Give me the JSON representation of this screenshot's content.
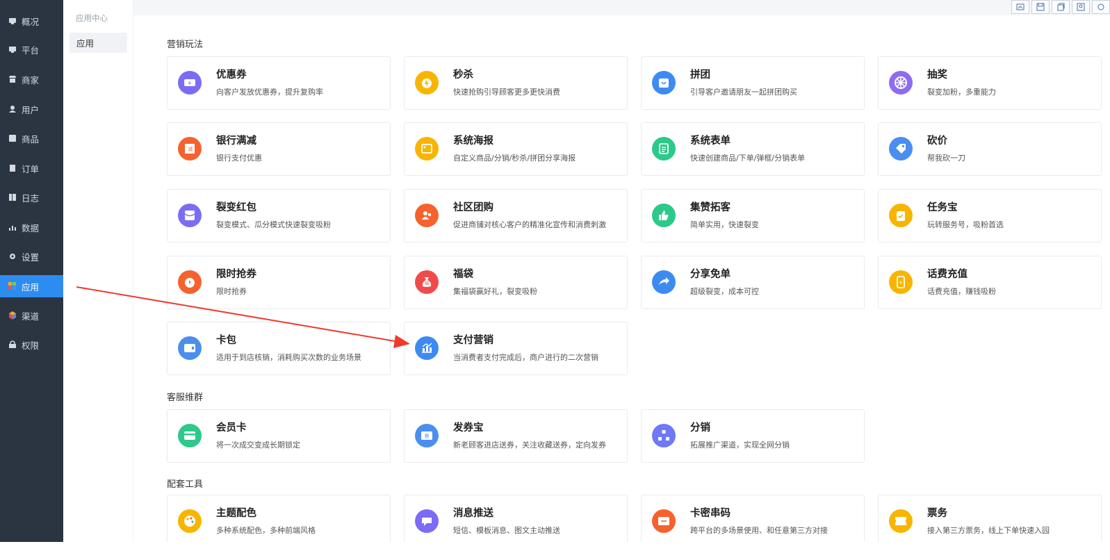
{
  "sidebar": {
    "items": [
      {
        "label": "概况",
        "icon": "dashboard-icon"
      },
      {
        "label": "平台",
        "icon": "monitor-icon"
      },
      {
        "label": "商家",
        "icon": "store-icon"
      },
      {
        "label": "用户",
        "icon": "user-icon"
      },
      {
        "label": "商品",
        "icon": "goods-icon"
      },
      {
        "label": "订单",
        "icon": "order-icon"
      },
      {
        "label": "日志",
        "icon": "log-icon"
      },
      {
        "label": "数据",
        "icon": "chart-icon"
      },
      {
        "label": "设置",
        "icon": "gear-icon"
      },
      {
        "label": "应用",
        "icon": "apps-icon"
      },
      {
        "label": "渠道",
        "icon": "cube-icon"
      },
      {
        "label": "权限",
        "icon": "lock-icon"
      }
    ],
    "active": "应用"
  },
  "subnav": {
    "title": "应用中心",
    "item": "应用"
  },
  "sections": [
    {
      "title": "营销玩法",
      "cards": [
        {
          "title": "优惠券",
          "desc": "向客户发放优惠券，提升复购率",
          "color": "#7b6cf6",
          "icon": "coupon-icon"
        },
        {
          "title": "秒杀",
          "desc": "快速抢购引导顾客更多更快消费",
          "color": "#f8b500",
          "icon": "alarm-clock-icon"
        },
        {
          "title": "拼团",
          "desc": "引导客户邀请朋友一起拼团购买",
          "color": "#3d8bf2",
          "icon": "shopping-bag-icon"
        },
        {
          "title": "抽奖",
          "desc": "裂变加粉，多重能力",
          "color": "#8e6cf2",
          "icon": "lottery-wheel-icon"
        },
        {
          "title": "银行满减",
          "desc": "银行支付优惠",
          "color": "#f6622d",
          "icon": "discount-icon"
        },
        {
          "title": "系统海报",
          "desc": "自定义商品/分销/秒杀/拼团分享海报",
          "color": "#f8b500",
          "icon": "image-icon"
        },
        {
          "title": "系统表单",
          "desc": "快速创建商品/下单/弹框/分销表单",
          "color": "#2cc98a",
          "icon": "form-icon"
        },
        {
          "title": "砍价",
          "desc": "帮我砍一刀",
          "color": "#4a8ef0",
          "icon": "price-tag-icon"
        },
        {
          "title": "裂变红包",
          "desc": "裂变模式、瓜分模式快速裂变吸粉",
          "color": "#7b6cf6",
          "icon": "red-envelope-icon"
        },
        {
          "title": "社区团购",
          "desc": "促进商铺对核心客户的精准化宣传和消费刺激",
          "color": "#f6622d",
          "icon": "group-icon"
        },
        {
          "title": "集赞拓客",
          "desc": "简单实用，快速裂变",
          "color": "#2cc98a",
          "icon": "thumbs-up-icon"
        },
        {
          "title": "任务宝",
          "desc": "玩转服务号，吸粉首选",
          "color": "#f8b500",
          "icon": "clipboard-check-icon"
        },
        {
          "title": "限时抢券",
          "desc": "限时抢券",
          "color": "#f6622d",
          "icon": "timer-icon"
        },
        {
          "title": "福袋",
          "desc": "集福袋赢好礼，裂变吸粉",
          "color": "#f04b4b",
          "icon": "lucky-bag-icon"
        },
        {
          "title": "分享免单",
          "desc": "超级裂变，成本可控",
          "color": "#3d8bf2",
          "icon": "share-icon"
        },
        {
          "title": "话费充值",
          "desc": "话费充值，赚钱吸粉",
          "color": "#f8b500",
          "icon": "phone-icon"
        },
        {
          "title": "卡包",
          "desc": "适用于到店核销，消耗购买次数的业务场景",
          "color": "#4a8ef0",
          "icon": "wallet-icon"
        },
        {
          "title": "支付营销",
          "desc": "当消费者支付完成后，商户进行的二次营销",
          "color": "#3d8bf2",
          "icon": "bar-chart-icon"
        }
      ]
    },
    {
      "title": "客服维群",
      "cards": [
        {
          "title": "会员卡",
          "desc": "将一次成交变成长期锁定",
          "color": "#2cc98a",
          "icon": "card-icon"
        },
        {
          "title": "发券宝",
          "desc": "新老顾客进店送券，关注收藏送券，定向发券",
          "color": "#4a8ef0",
          "icon": "ticket-icon"
        },
        {
          "title": "分销",
          "desc": "拓展推广渠道，实现全网分销",
          "color": "#6f78f5",
          "icon": "hierarchy-icon"
        }
      ]
    },
    {
      "title": "配套工具",
      "cards": [
        {
          "title": "主题配色",
          "desc": "多种系统配色，多种前端风格",
          "color": "#f8b500",
          "icon": "palette-icon"
        },
        {
          "title": "消息推送",
          "desc": "短信、模板消息、图文主动推送",
          "color": "#7b6cf6",
          "icon": "chat-icon"
        },
        {
          "title": "卡密串码",
          "desc": "跨平台的多场景使用、和任意第三方对接",
          "color": "#f6622d",
          "icon": "card-code-icon"
        },
        {
          "title": "票务",
          "desc": "接入第三方票务，线上下单快速入园",
          "color": "#f8b500",
          "icon": "ticket-stub-icon"
        }
      ]
    }
  ],
  "toolbar": {
    "buttons": [
      "screenshot-icon",
      "save-icon",
      "copy-icon",
      "image-export-icon",
      "settings-icon"
    ]
  },
  "annotation": {
    "color": "#f03a2e"
  }
}
